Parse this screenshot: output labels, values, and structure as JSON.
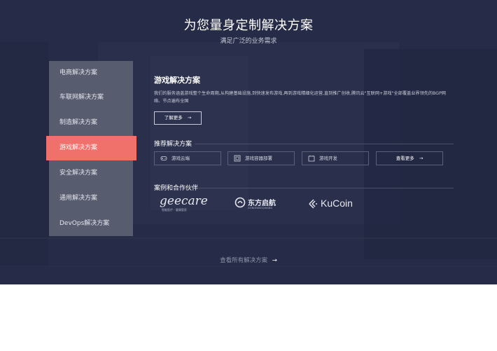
{
  "header": {
    "title": "为您量身定制解决方案",
    "subtitle": "满足广泛的业务需求"
  },
  "sidebar": {
    "items": [
      {
        "label": "电商解决方案",
        "active": false
      },
      {
        "label": "车联网解决方案",
        "active": false
      },
      {
        "label": "制造解决方案",
        "active": false
      },
      {
        "label": "游戏解决方案",
        "active": true
      },
      {
        "label": "安全解决方案",
        "active": false
      },
      {
        "label": "通用解决方案",
        "active": false
      },
      {
        "label": "DevOps解决方案",
        "active": false
      }
    ]
  },
  "content": {
    "title": "游戏解决方案",
    "description": "我们的服务涵盖游戏整个生命周期,从构建基础设施,到快速发布游戏,再到游戏精细化运营,直到推广创收,腾讯云\"互联网+游戏\"全部覆盖业界领先的BGP网络、节点遍布全国",
    "learn_more": "了解更多",
    "arrow": "→"
  },
  "recommended": {
    "label": "推荐解决方案",
    "items": [
      {
        "label": "游戏云端",
        "icon": "gamepad-icon"
      },
      {
        "label": "游戏容器部署",
        "icon": "container-icon"
      },
      {
        "label": "游戏开发",
        "icon": "dev-icon"
      }
    ],
    "more": "查看更多"
  },
  "partners": {
    "label": "案例和合作伙伴",
    "items": [
      {
        "name": "geecare",
        "tagline": "智能医疗 · 健康管家"
      },
      {
        "name": "东方启航",
        "tagline": "DONGFANGQIHANG"
      },
      {
        "name": "KuCoin"
      }
    ]
  },
  "footer": {
    "link": "查看所有解决方案",
    "arrow": "→"
  },
  "colors": {
    "background": "#252b45",
    "sidebar": "#585c6f",
    "accent": "#f0706b"
  }
}
